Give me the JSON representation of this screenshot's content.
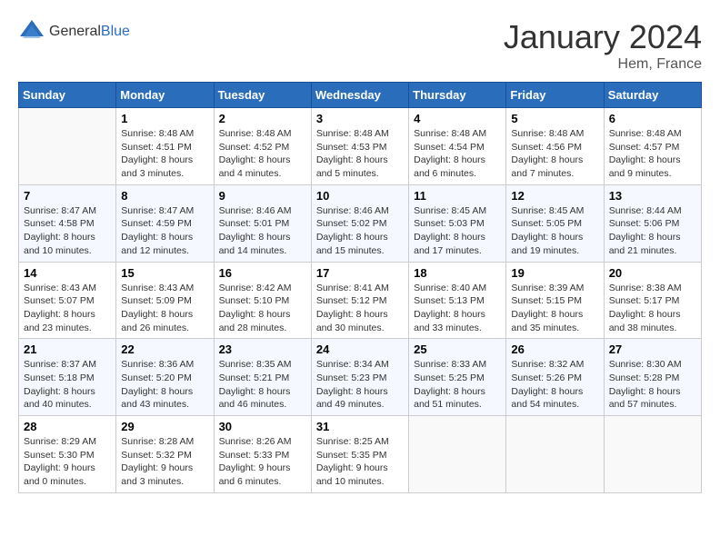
{
  "header": {
    "logo_general": "General",
    "logo_blue": "Blue",
    "month_title": "January 2024",
    "location": "Hem, France"
  },
  "weekdays": [
    "Sunday",
    "Monday",
    "Tuesday",
    "Wednesday",
    "Thursday",
    "Friday",
    "Saturday"
  ],
  "weeks": [
    [
      {
        "num": "",
        "sunrise": "",
        "sunset": "",
        "daylight": ""
      },
      {
        "num": "1",
        "sunrise": "Sunrise: 8:48 AM",
        "sunset": "Sunset: 4:51 PM",
        "daylight": "Daylight: 8 hours and 3 minutes."
      },
      {
        "num": "2",
        "sunrise": "Sunrise: 8:48 AM",
        "sunset": "Sunset: 4:52 PM",
        "daylight": "Daylight: 8 hours and 4 minutes."
      },
      {
        "num": "3",
        "sunrise": "Sunrise: 8:48 AM",
        "sunset": "Sunset: 4:53 PM",
        "daylight": "Daylight: 8 hours and 5 minutes."
      },
      {
        "num": "4",
        "sunrise": "Sunrise: 8:48 AM",
        "sunset": "Sunset: 4:54 PM",
        "daylight": "Daylight: 8 hours and 6 minutes."
      },
      {
        "num": "5",
        "sunrise": "Sunrise: 8:48 AM",
        "sunset": "Sunset: 4:56 PM",
        "daylight": "Daylight: 8 hours and 7 minutes."
      },
      {
        "num": "6",
        "sunrise": "Sunrise: 8:48 AM",
        "sunset": "Sunset: 4:57 PM",
        "daylight": "Daylight: 8 hours and 9 minutes."
      }
    ],
    [
      {
        "num": "7",
        "sunrise": "Sunrise: 8:47 AM",
        "sunset": "Sunset: 4:58 PM",
        "daylight": "Daylight: 8 hours and 10 minutes."
      },
      {
        "num": "8",
        "sunrise": "Sunrise: 8:47 AM",
        "sunset": "Sunset: 4:59 PM",
        "daylight": "Daylight: 8 hours and 12 minutes."
      },
      {
        "num": "9",
        "sunrise": "Sunrise: 8:46 AM",
        "sunset": "Sunset: 5:01 PM",
        "daylight": "Daylight: 8 hours and 14 minutes."
      },
      {
        "num": "10",
        "sunrise": "Sunrise: 8:46 AM",
        "sunset": "Sunset: 5:02 PM",
        "daylight": "Daylight: 8 hours and 15 minutes."
      },
      {
        "num": "11",
        "sunrise": "Sunrise: 8:45 AM",
        "sunset": "Sunset: 5:03 PM",
        "daylight": "Daylight: 8 hours and 17 minutes."
      },
      {
        "num": "12",
        "sunrise": "Sunrise: 8:45 AM",
        "sunset": "Sunset: 5:05 PM",
        "daylight": "Daylight: 8 hours and 19 minutes."
      },
      {
        "num": "13",
        "sunrise": "Sunrise: 8:44 AM",
        "sunset": "Sunset: 5:06 PM",
        "daylight": "Daylight: 8 hours and 21 minutes."
      }
    ],
    [
      {
        "num": "14",
        "sunrise": "Sunrise: 8:43 AM",
        "sunset": "Sunset: 5:07 PM",
        "daylight": "Daylight: 8 hours and 23 minutes."
      },
      {
        "num": "15",
        "sunrise": "Sunrise: 8:43 AM",
        "sunset": "Sunset: 5:09 PM",
        "daylight": "Daylight: 8 hours and 26 minutes."
      },
      {
        "num": "16",
        "sunrise": "Sunrise: 8:42 AM",
        "sunset": "Sunset: 5:10 PM",
        "daylight": "Daylight: 8 hours and 28 minutes."
      },
      {
        "num": "17",
        "sunrise": "Sunrise: 8:41 AM",
        "sunset": "Sunset: 5:12 PM",
        "daylight": "Daylight: 8 hours and 30 minutes."
      },
      {
        "num": "18",
        "sunrise": "Sunrise: 8:40 AM",
        "sunset": "Sunset: 5:13 PM",
        "daylight": "Daylight: 8 hours and 33 minutes."
      },
      {
        "num": "19",
        "sunrise": "Sunrise: 8:39 AM",
        "sunset": "Sunset: 5:15 PM",
        "daylight": "Daylight: 8 hours and 35 minutes."
      },
      {
        "num": "20",
        "sunrise": "Sunrise: 8:38 AM",
        "sunset": "Sunset: 5:17 PM",
        "daylight": "Daylight: 8 hours and 38 minutes."
      }
    ],
    [
      {
        "num": "21",
        "sunrise": "Sunrise: 8:37 AM",
        "sunset": "Sunset: 5:18 PM",
        "daylight": "Daylight: 8 hours and 40 minutes."
      },
      {
        "num": "22",
        "sunrise": "Sunrise: 8:36 AM",
        "sunset": "Sunset: 5:20 PM",
        "daylight": "Daylight: 8 hours and 43 minutes."
      },
      {
        "num": "23",
        "sunrise": "Sunrise: 8:35 AM",
        "sunset": "Sunset: 5:21 PM",
        "daylight": "Daylight: 8 hours and 46 minutes."
      },
      {
        "num": "24",
        "sunrise": "Sunrise: 8:34 AM",
        "sunset": "Sunset: 5:23 PM",
        "daylight": "Daylight: 8 hours and 49 minutes."
      },
      {
        "num": "25",
        "sunrise": "Sunrise: 8:33 AM",
        "sunset": "Sunset: 5:25 PM",
        "daylight": "Daylight: 8 hours and 51 minutes."
      },
      {
        "num": "26",
        "sunrise": "Sunrise: 8:32 AM",
        "sunset": "Sunset: 5:26 PM",
        "daylight": "Daylight: 8 hours and 54 minutes."
      },
      {
        "num": "27",
        "sunrise": "Sunrise: 8:30 AM",
        "sunset": "Sunset: 5:28 PM",
        "daylight": "Daylight: 8 hours and 57 minutes."
      }
    ],
    [
      {
        "num": "28",
        "sunrise": "Sunrise: 8:29 AM",
        "sunset": "Sunset: 5:30 PM",
        "daylight": "Daylight: 9 hours and 0 minutes."
      },
      {
        "num": "29",
        "sunrise": "Sunrise: 8:28 AM",
        "sunset": "Sunset: 5:32 PM",
        "daylight": "Daylight: 9 hours and 3 minutes."
      },
      {
        "num": "30",
        "sunrise": "Sunrise: 8:26 AM",
        "sunset": "Sunset: 5:33 PM",
        "daylight": "Daylight: 9 hours and 6 minutes."
      },
      {
        "num": "31",
        "sunrise": "Sunrise: 8:25 AM",
        "sunset": "Sunset: 5:35 PM",
        "daylight": "Daylight: 9 hours and 10 minutes."
      },
      {
        "num": "",
        "sunrise": "",
        "sunset": "",
        "daylight": ""
      },
      {
        "num": "",
        "sunrise": "",
        "sunset": "",
        "daylight": ""
      },
      {
        "num": "",
        "sunrise": "",
        "sunset": "",
        "daylight": ""
      }
    ]
  ]
}
